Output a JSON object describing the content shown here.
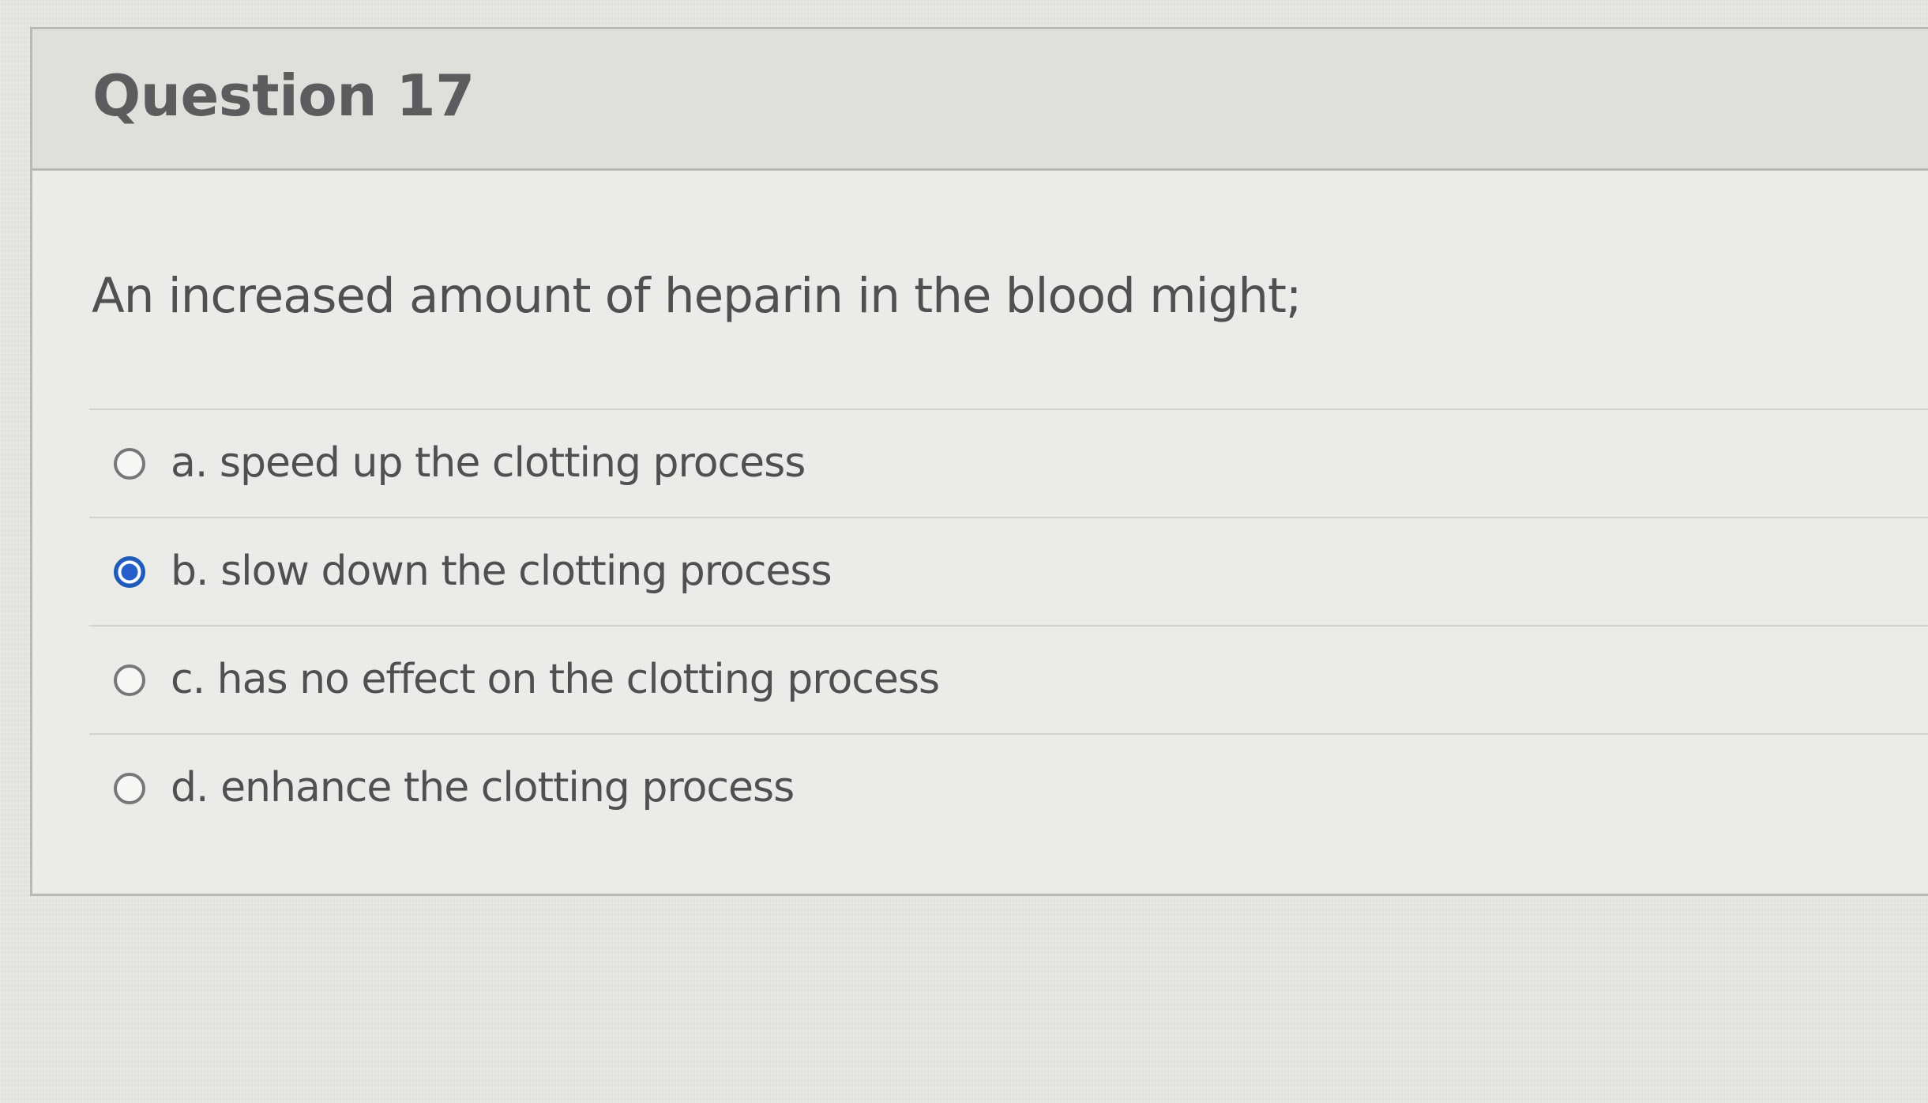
{
  "question": {
    "title": "Question 17",
    "prompt": "An increased amount of heparin in the blood might;",
    "answers": [
      {
        "label": "a. speed up the clotting process",
        "selected": false
      },
      {
        "label": "b. slow down the clotting process",
        "selected": true
      },
      {
        "label": "c. has no effect on the clotting process",
        "selected": false
      },
      {
        "label": "d. enhance the clotting process",
        "selected": false
      }
    ]
  },
  "colors": {
    "selected_radio": "#245fca",
    "text": "#4f5052",
    "border": "#b8b8b6"
  }
}
